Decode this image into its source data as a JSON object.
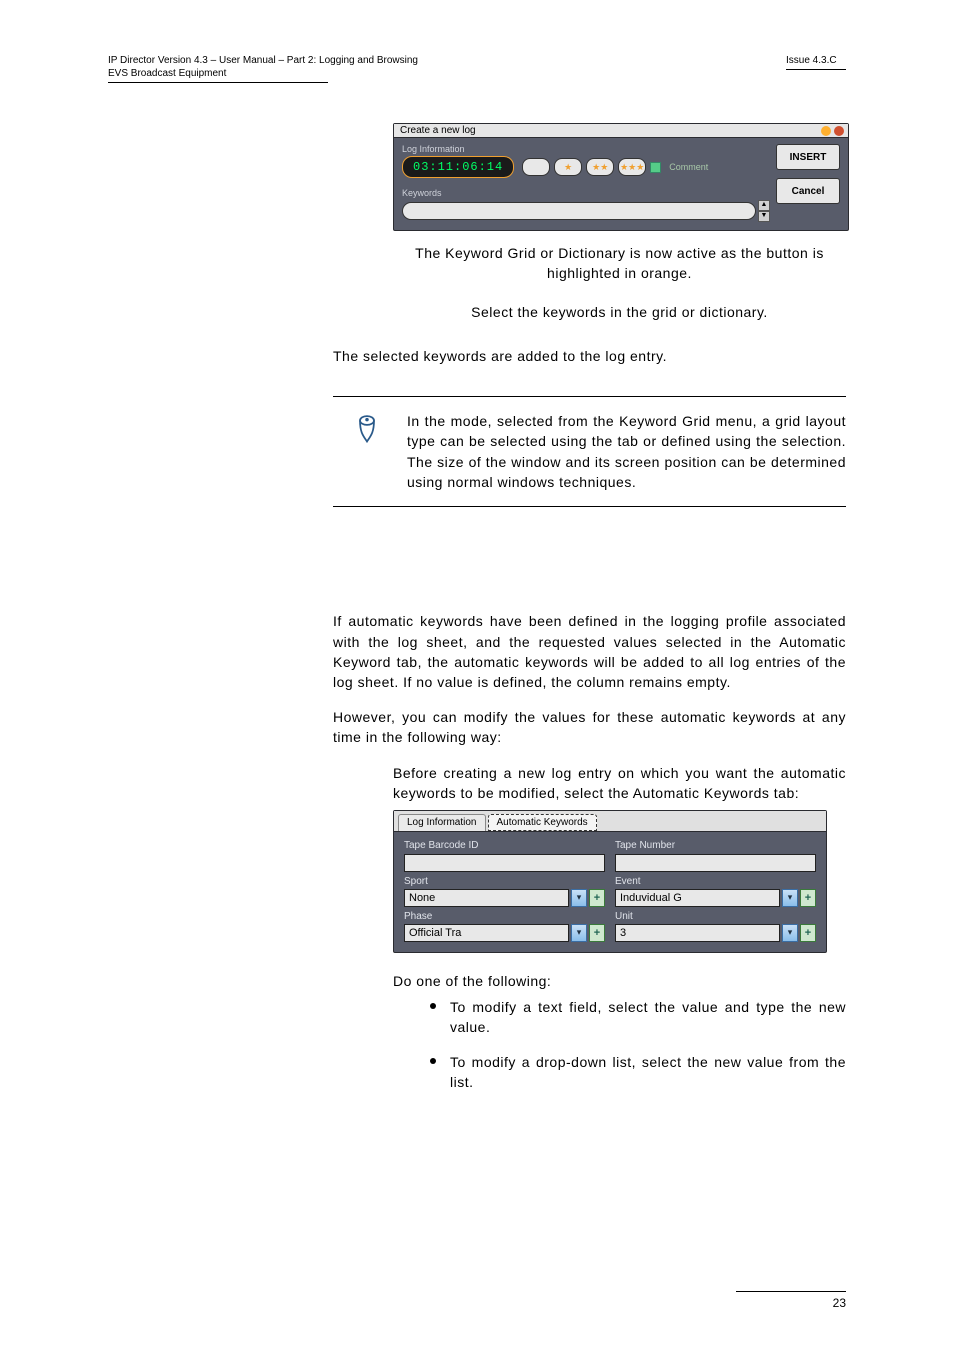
{
  "header": {
    "left_line1": "IP Director Version 4.3 – User Manual – Part 2: Logging and Browsing",
    "left_line2": "EVS Broadcast Equipment",
    "right": "Issue 4.3.C"
  },
  "shot1": {
    "title": "Create a new log",
    "log_information_label": "Log Information",
    "timecode": "03:11:06:14",
    "star1": "★",
    "star2": "★★",
    "star3": "★★★",
    "comment_label": "Comment",
    "keywords_label": "Keywords",
    "insert_btn": "INSERT",
    "cancel_btn": "Cancel"
  },
  "body": {
    "p1": "The Keyword Grid or Dictionary is now active as the button is highlighted in orange.",
    "p2": "Select the keywords in the grid or dictionary.",
    "p3": "The selected keywords are added to the log entry.",
    "note": "In the       mode, selected from the Keyword Grid menu, a grid layout type can be selected using the tab or defined using the selection. The size of the window and its screen position can be determined using normal windows techniques.",
    "p4": "If automatic keywords have been defined in the logging profile associated with the log sheet, and the requested values selected in the Automatic Keyword tab, the automatic keywords will be added to all log entries of the log sheet. If no value is defined, the column remains empty.",
    "p5": "However, you can modify the values for these automatic keywords at any time in the following way:",
    "p6": "Before creating a new log entry on which you want the automatic keywords to be modified, select the Automatic Keywords tab:",
    "p7": "Do one of the following:",
    "b1": "To modify a text field, select the value and type the new value.",
    "b2": "To modify a drop-down list, select the new value from the list."
  },
  "shot2": {
    "tab1": "Log Information",
    "tab2": "Automatic Keywords",
    "tape_barcode_label": "Tape Barcode ID",
    "tape_barcode_value": "",
    "tape_number_label": "Tape Number",
    "tape_number_value": "",
    "sport_label": "Sport",
    "sport_value": "None",
    "event_label": "Event",
    "event_value": "Induvidual G",
    "phase_label": "Phase",
    "phase_value": "Official Tra",
    "unit_label": "Unit",
    "unit_value": "3"
  },
  "footer": {
    "page_number": "23"
  }
}
